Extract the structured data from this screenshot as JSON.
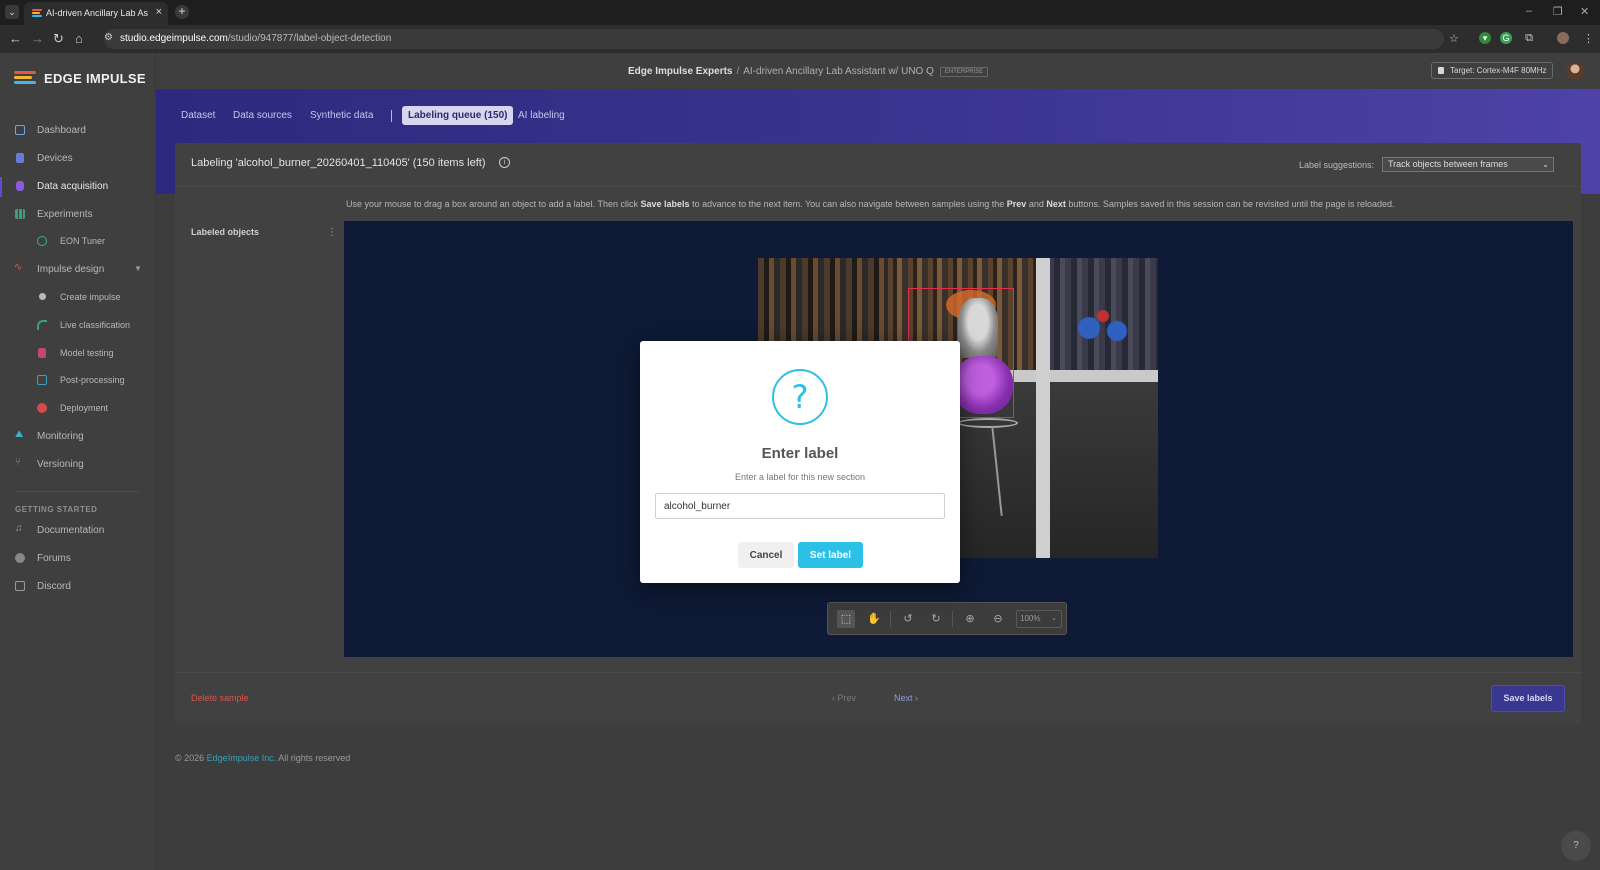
{
  "browser": {
    "tab_title": "AI-driven Ancillary Lab Assista",
    "url_host": "studio.edgeimpulse.com",
    "url_path": "/studio/947877/label-object-detection"
  },
  "sidebar": {
    "brand": "EDGE IMPULSE",
    "items": [
      {
        "label": "Dashboard"
      },
      {
        "label": "Devices"
      },
      {
        "label": "Data acquisition"
      },
      {
        "label": "Experiments"
      },
      {
        "label": "EON Tuner"
      },
      {
        "label": "Impulse design"
      },
      {
        "label": "Create impulse"
      },
      {
        "label": "Live classification"
      },
      {
        "label": "Model testing"
      },
      {
        "label": "Post-processing"
      },
      {
        "label": "Deployment"
      },
      {
        "label": "Monitoring"
      },
      {
        "label": "Versioning"
      }
    ],
    "section_title": "GETTING STARTED",
    "help_items": [
      {
        "label": "Documentation"
      },
      {
        "label": "Forums"
      },
      {
        "label": "Discord"
      }
    ]
  },
  "header": {
    "org": "Edge Impulse Experts",
    "separator": "/",
    "project": "AI-driven Ancillary Lab Assistant w/ UNO Q",
    "badge": "ENTERPRISE",
    "target": "Target: Cortex-M4F 80MHz"
  },
  "subtabs": [
    {
      "label": "Dataset"
    },
    {
      "label": "Data sources"
    },
    {
      "label": "Synthetic data"
    },
    {
      "label": "Labeling queue (150)"
    },
    {
      "label": "AI labeling"
    }
  ],
  "labeling": {
    "title": "Labeling 'alcohol_burner_20260401_110405' (150 items left)",
    "suggestions_label": "Label suggestions:",
    "suggestions_value": "Track objects between frames",
    "instructions": {
      "p1": "Use your mouse to drag a box around an object to add a label. Then click ",
      "b1": "Save labels",
      "p2": " to advance to the next item. You can also navigate between samples using the ",
      "b2": "Prev",
      "p3": " and ",
      "b3": "Next",
      "p4": " buttons. Samples saved in this session can be revisited until the page is reloaded."
    },
    "labeled_objects_title": "Labeled objects",
    "zoom": "100%",
    "delete_label": "Delete sample",
    "prev_label": "Prev",
    "next_label": "Next",
    "save_label": "Save labels"
  },
  "footer": {
    "prefix": "© 2026",
    "company": "EdgeImpulse Inc.",
    "suffix": "All rights reserved"
  },
  "modal": {
    "icon": "question-icon",
    "title": "Enter label",
    "subtitle": "Enter a label for this new section",
    "input_value": "alcohol_burner",
    "cancel_label": "Cancel",
    "confirm_label": "Set label"
  },
  "colors": {
    "accent": "#2cc0e6",
    "brand_purple": "#39378f",
    "bbox": "#e0304a",
    "danger": "#d9534f"
  }
}
